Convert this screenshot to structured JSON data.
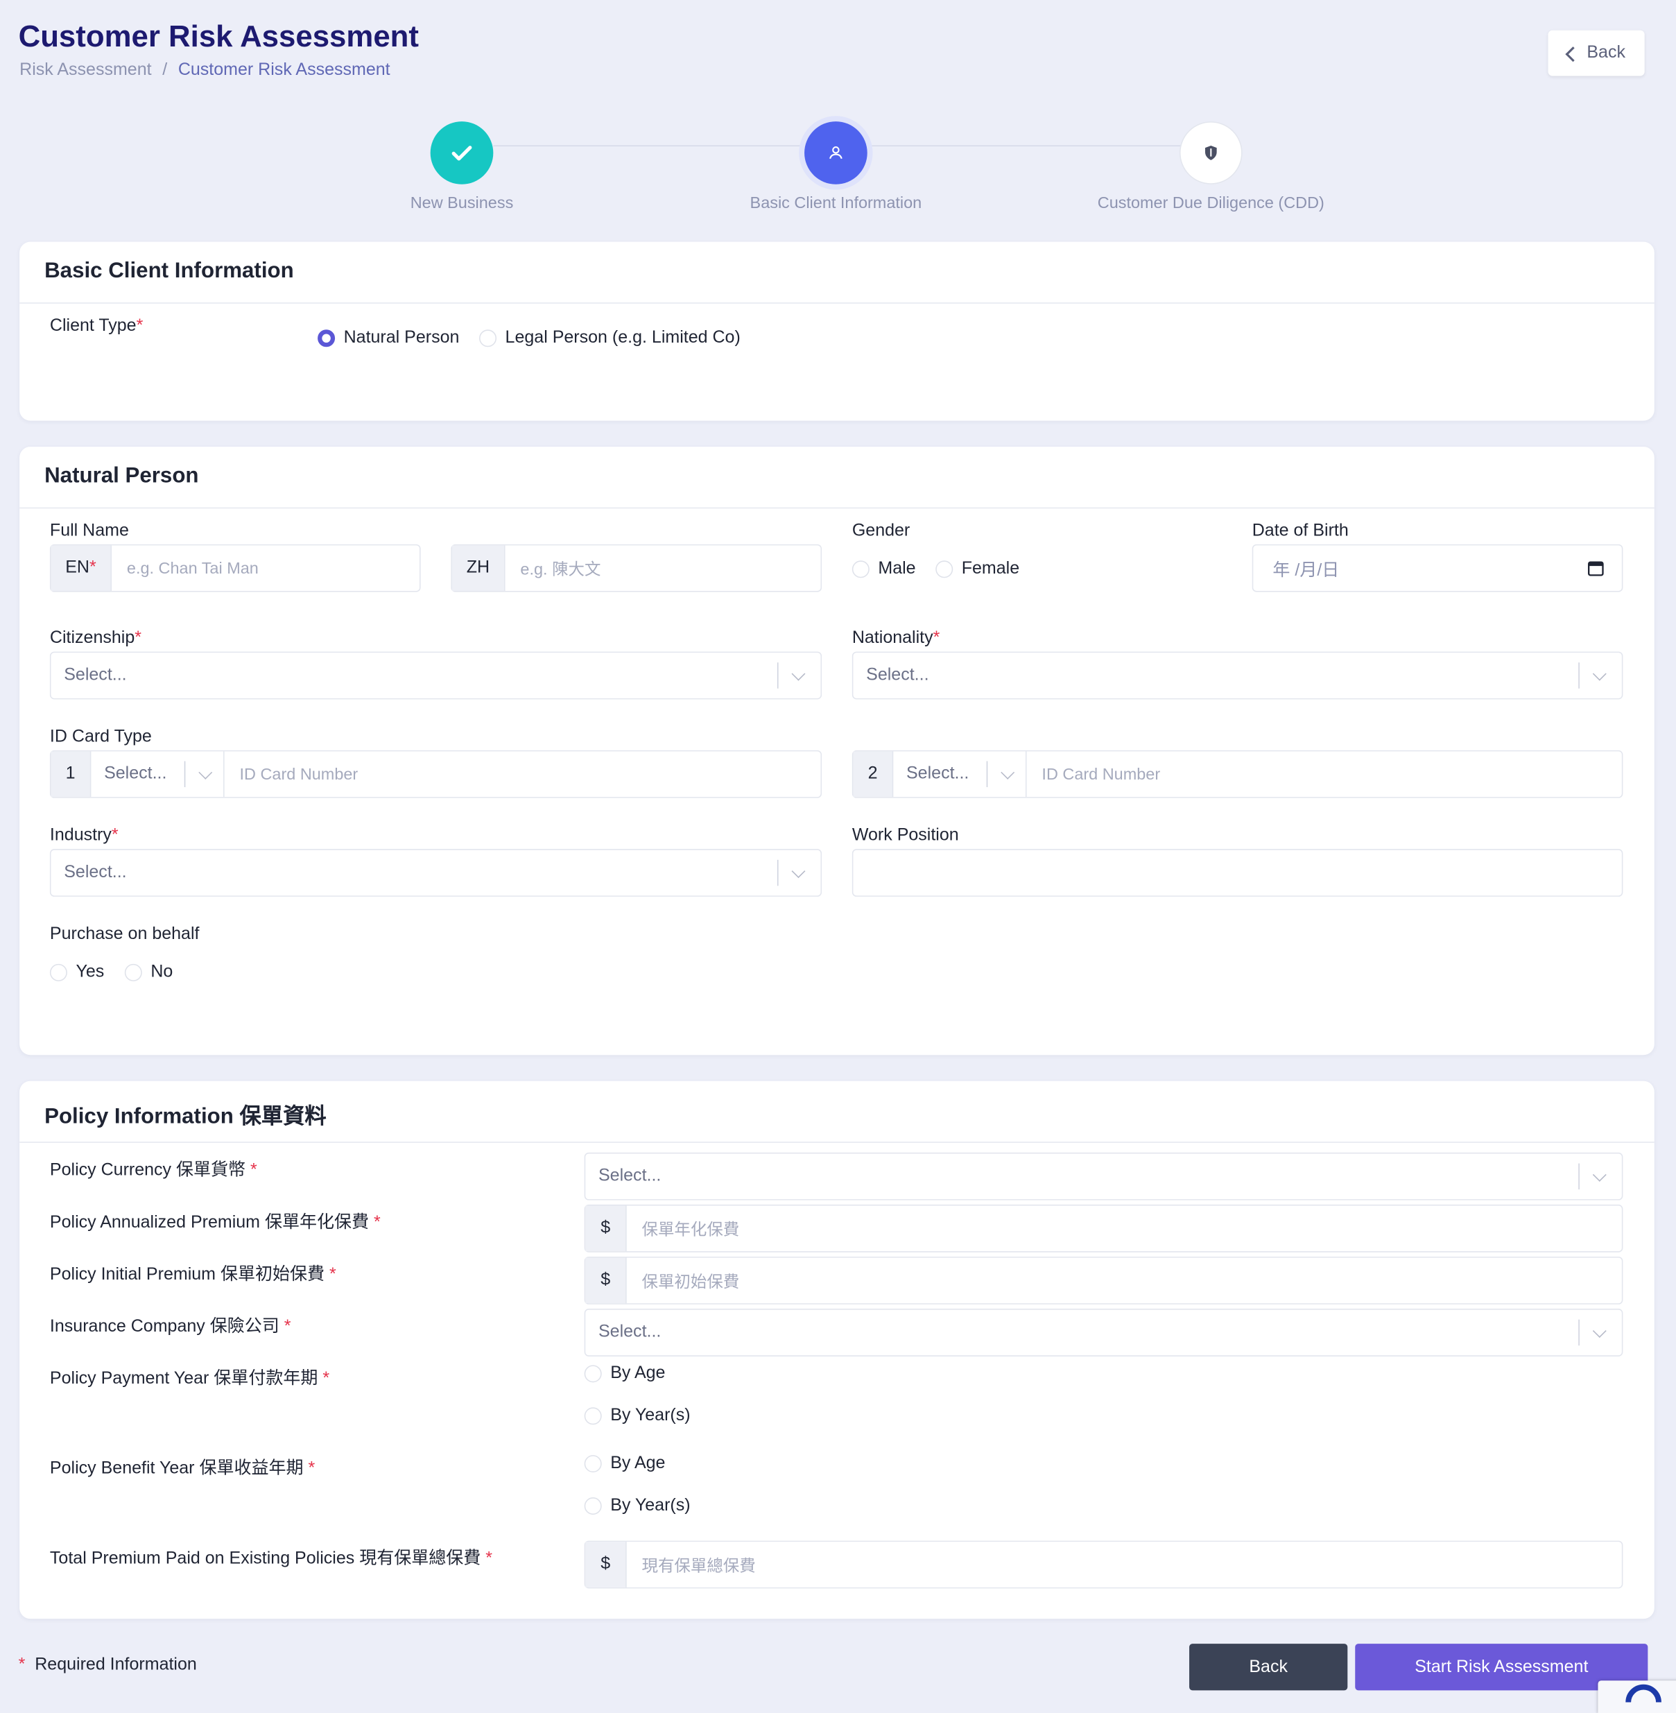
{
  "header": {
    "title": "Customer Risk Assessment",
    "breadcrumb": [
      "Risk Assessment",
      "Customer Risk Assessment"
    ],
    "back_label": "Back"
  },
  "stepper": {
    "steps": [
      {
        "label": "New Business",
        "state": "done",
        "icon": "check-icon"
      },
      {
        "label": "Basic Client Information",
        "state": "active",
        "icon": "user-icon"
      },
      {
        "label": "Customer Due Diligence (CDD)",
        "state": "pending",
        "icon": "shield-icon"
      }
    ]
  },
  "basic_info": {
    "title": "Basic Client Information",
    "client_type_label": "Client Type",
    "options": [
      "Natural Person",
      "Legal Person (e.g. Limited Co)"
    ],
    "selected": "Natural Person"
  },
  "natural_person": {
    "title": "Natural Person",
    "full_name_label": "Full Name",
    "en_addon": "EN",
    "en_placeholder": "e.g. Chan Tai Man",
    "zh_addon": "ZH",
    "zh_placeholder": "e.g. 陳大文",
    "gender_label": "Gender",
    "gender_options": [
      "Male",
      "Female"
    ],
    "dob_label": "Date of Birth",
    "dob_placeholder": "年 /月/日",
    "citizenship_label": "Citizenship",
    "nationality_label": "Nationality",
    "select_placeholder": "Select...",
    "id_card_label": "ID Card Type",
    "id_numbers": [
      "1",
      "2"
    ],
    "id_number_placeholder": "ID Card Number",
    "industry_label": "Industry",
    "work_position_label": "Work Position",
    "purchase_label": "Purchase on behalf",
    "purchase_options": [
      "Yes",
      "No"
    ]
  },
  "policy": {
    "title": "Policy Information 保單資料",
    "currency_label": "Policy Currency 保單貨幣",
    "annual_label": "Policy Annualized Premium 保單年化保費",
    "annual_placeholder": "保單年化保費",
    "initial_label": "Policy Initial Premium 保單初始保費",
    "initial_placeholder": "保單初始保費",
    "company_label": "Insurance Company 保險公司",
    "payment_label": "Policy Payment Year 保單付款年期",
    "benefit_label": "Policy Benefit Year 保單收益年期",
    "year_options": [
      "By Age",
      "By Year(s)"
    ],
    "total_label": "Total Premium Paid on Existing Policies 現有保單總保費",
    "total_placeholder": "現有保單總保費",
    "currency_symbol": "$"
  },
  "footer": {
    "required_note": "Required Information",
    "back_label": "Back",
    "start_label": "Start Risk Assessment"
  },
  "colors": {
    "accent": "#5b57d6",
    "done": "#16c7c3",
    "active": "#4f63ee",
    "title": "#1d1a70",
    "back_button": "#3b4356"
  }
}
